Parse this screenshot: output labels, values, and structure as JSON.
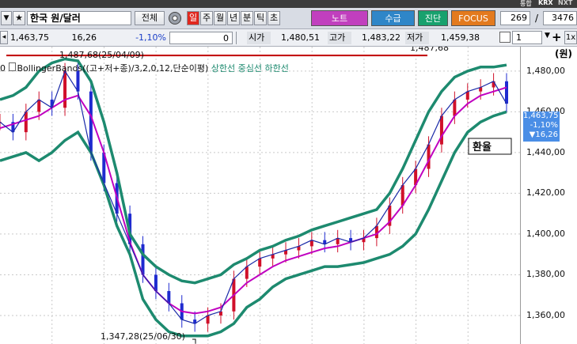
{
  "top_strip": {
    "labels": [
      "통합",
      "KRX",
      "NXT"
    ]
  },
  "toolbar": {
    "symbol_name": "한국 원/달러",
    "all_label": "전체",
    "periods": [
      "일",
      "주",
      "월",
      "년",
      "분",
      "틱",
      "초"
    ],
    "active_period": "일",
    "buttons": {
      "note": "노트",
      "supply": "수급",
      "diagnose": "진단",
      "focus": "FOCUS"
    },
    "count_a": "269",
    "count_b": "3476"
  },
  "quote": {
    "price": "1,463,75",
    "change": "16,26",
    "change_pct": "-1,10%",
    "volume": "0",
    "open_label": "시가",
    "open": "1,480,51",
    "high_label": "고가",
    "high": "1,483,22",
    "low_label": "저가",
    "low": "1,459,38",
    "select_value": "1",
    "zoom_label": "1x"
  },
  "chart": {
    "legend_prefix": "0 ",
    "legend_main": "BollingerBands((고+저+종)/3,2,0,12,단순이평)",
    "legend_upper": "상한선",
    "legend_mid": "중심선",
    "legend_lower": "하한선",
    "axis_unit": "(원)",
    "high_annotation": "1,487,68(25/04/09)",
    "hline_label": "1,487,68",
    "low_annotation": "1,347,28(25/06/30)",
    "callout": "환율",
    "last_price": "1,463,75",
    "last_change_pct": "-1,10%",
    "last_change": "▼16,26",
    "colors": {
      "upper_band": "#1d8a6f",
      "mid": "#c000c0",
      "lower": "#1d8a6f",
      "accent_red": "#c00000"
    }
  },
  "chart_data": {
    "type": "line",
    "title": "",
    "xlabel": "",
    "ylabel": "",
    "ylim": [
      1346,
      1492
    ],
    "yticks": [
      1360,
      1380,
      1400,
      1420,
      1440,
      1460,
      1480
    ],
    "series": [
      {
        "name": "상한선",
        "values": [
          1466,
          1468,
          1472,
          1480,
          1484,
          1486,
          1485,
          1475,
          1455,
          1430,
          1400,
          1390,
          1384,
          1380,
          1377,
          1376,
          1378,
          1380,
          1385,
          1388,
          1392,
          1394,
          1397,
          1399,
          1402,
          1404,
          1406,
          1408,
          1410,
          1412,
          1420,
          1432,
          1446,
          1460,
          1470,
          1477,
          1480,
          1482,
          1482,
          1483
        ]
      },
      {
        "name": "중심선",
        "values": [
          1452,
          1454,
          1456,
          1458,
          1462,
          1466,
          1468,
          1458,
          1440,
          1418,
          1396,
          1380,
          1372,
          1366,
          1362,
          1361,
          1362,
          1364,
          1370,
          1376,
          1380,
          1384,
          1387,
          1389,
          1391,
          1393,
          1394,
          1396,
          1398,
          1400,
          1406,
          1414,
          1424,
          1436,
          1448,
          1458,
          1464,
          1468,
          1470,
          1472
        ]
      },
      {
        "name": "하한선",
        "values": [
          1436,
          1438,
          1440,
          1436,
          1440,
          1446,
          1450,
          1440,
          1424,
          1404,
          1390,
          1368,
          1358,
          1352,
          1350,
          1350,
          1350,
          1352,
          1356,
          1364,
          1368,
          1374,
          1378,
          1380,
          1382,
          1384,
          1384,
          1385,
          1386,
          1388,
          1390,
          1394,
          1400,
          1412,
          1426,
          1440,
          1450,
          1455,
          1458,
          1460
        ]
      },
      {
        "name": "환율",
        "values": [
          1455,
          1450,
          1460,
          1466,
          1462,
          1480,
          1470,
          1440,
          1425,
          1410,
          1395,
          1380,
          1372,
          1366,
          1358,
          1356,
          1360,
          1362,
          1378,
          1384,
          1388,
          1390,
          1392,
          1394,
          1397,
          1395,
          1398,
          1396,
          1398,
          1404,
          1414,
          1424,
          1432,
          1444,
          1458,
          1466,
          1470,
          1472,
          1475,
          1464
        ]
      }
    ],
    "horizontal_line": 1487.68,
    "high_point": {
      "value": 1487.68,
      "label": "1,487,68(25/04/09)"
    },
    "low_point": {
      "value": 1347.28,
      "label": "1,347,28(25/06/30)"
    },
    "grid": true,
    "legend_placement": "top-left"
  }
}
